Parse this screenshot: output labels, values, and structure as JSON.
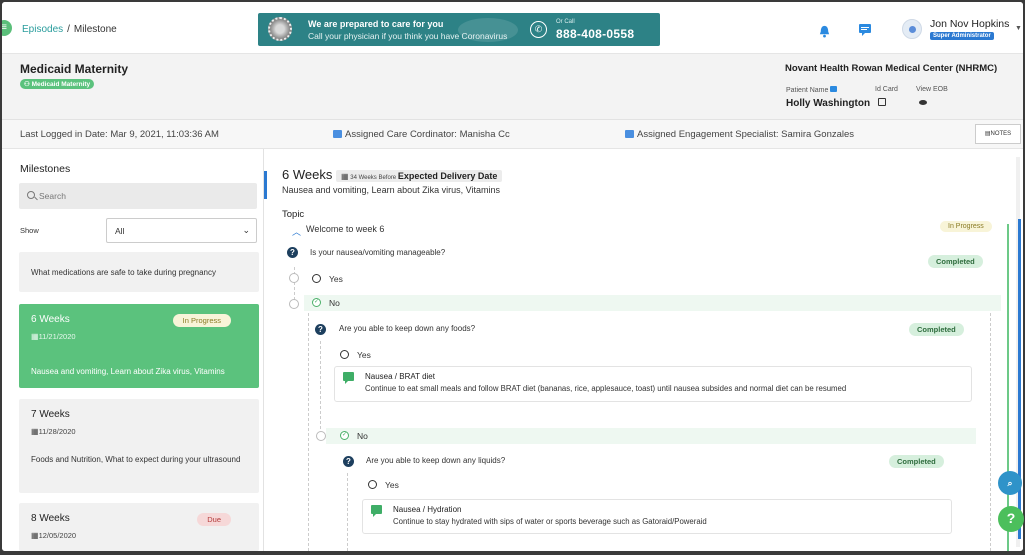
{
  "breadcrumb": {
    "parent": "Episodes",
    "current": "Milestone"
  },
  "banner": {
    "line1": "We are prepared to care for you",
    "line2": "Call your physician if you think you have Coronavirus",
    "or_call": "Or Call",
    "phone": "888-408-0558"
  },
  "user": {
    "name": "Jon Nov Hopkins",
    "role": "Super Administrator"
  },
  "patient": {
    "program": "Medicaid Maternity",
    "program_badge": "Medicaid Maternity",
    "facility": "Novant Health Rowan Medical Center (NHRMC)",
    "patient_name_label": "Patient Name",
    "patient_name": "Holly Washington",
    "id_card_label": "Id Card",
    "view_eob_label": "View EOB"
  },
  "infobar": {
    "last_logged": "Last Logged in Date: Mar 9, 2021, 11:03:36 AM",
    "care_coordinator": "Assigned Care Cordinator: Manisha Cc",
    "engagement": "Assigned Engagement Specialist: Samira Gonzales",
    "notes_button": "NOTES"
  },
  "sidebar": {
    "title": "Milestones",
    "search_placeholder": "Search",
    "show_label": "Show",
    "show_value": "All",
    "items": [
      {
        "topics": "What medications are safe to take during pregnancy"
      },
      {
        "week": "6 Weeks",
        "date": "11/21/2020",
        "status": "In Progress",
        "topics": "Nausea and vomiting, Learn about Zika virus, Vitamins"
      },
      {
        "week": "7 Weeks",
        "date": "11/28/2020",
        "topics": "Foods and Nutrition, What to expect during your ultrasound"
      },
      {
        "week": "8 Weeks",
        "date": "12/05/2020",
        "status": "Due"
      }
    ]
  },
  "main": {
    "week_title": "6 Weeks",
    "badge_small": "34 Weeks Before",
    "badge_big": "Expected Delivery Date",
    "topics": "Nausea and vomiting, Learn about Zika virus, Vitamins",
    "topic_label": "Topic",
    "welcome": "Welcome to week 6",
    "welcome_status": "In Progress",
    "q1": "Is your nausea/vomiting manageable?",
    "q1_status": "Completed",
    "yes": "Yes",
    "no": "No",
    "q2": "Are you able to keep down any foods?",
    "q2_status": "Completed",
    "tip1_title": "Nausea / BRAT diet",
    "tip1_body": "Continue to eat small meals and follow BRAT diet (bananas, rice, applesauce, toast) until nausea subsides and normal diet can be resumed",
    "q3": "Are you able to keep down any liquids?",
    "q3_status": "Completed",
    "tip2_title": "Nausea / Hydration",
    "tip2_body": "Continue to stay hydrated with sips of water or sports beverage such as Gatoraid/Poweraid"
  },
  "colors": {
    "accent_green": "#5bc27d",
    "accent_blue": "#2b79d1",
    "banner_teal": "#2d8286"
  }
}
